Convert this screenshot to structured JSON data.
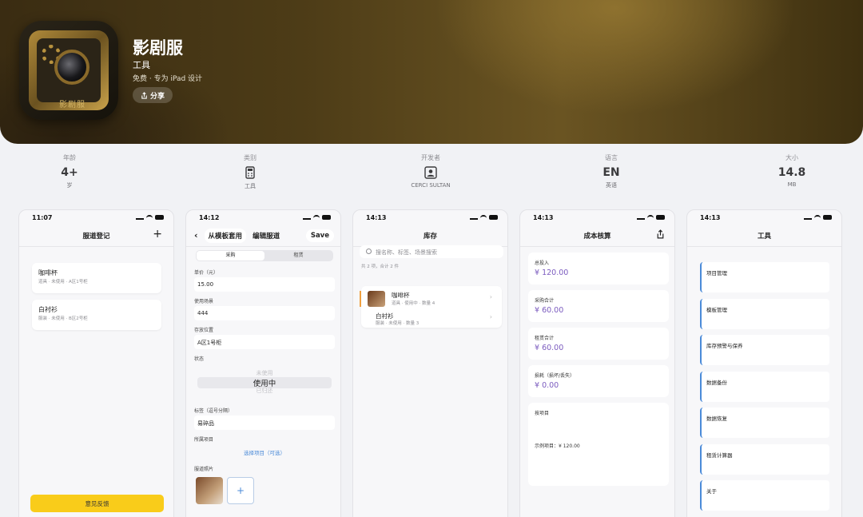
{
  "app": {
    "title": "影剧服",
    "category": "工具",
    "subtitle": "免费 · 专为 iPad 设计",
    "share_label": "分享",
    "icon_text": "影剧服"
  },
  "stats": [
    {
      "label": "年龄",
      "value": "4+",
      "sub": "岁"
    },
    {
      "label": "类别",
      "value": "",
      "sub": "工具",
      "icon": "calculator-icon"
    },
    {
      "label": "开发者",
      "value": "",
      "sub": "CERCI SULTAN",
      "icon": "person-icon"
    },
    {
      "label": "语言",
      "value": "EN",
      "sub": "英语"
    },
    {
      "label": "大小",
      "value": "14.8",
      "sub": "MB"
    }
  ],
  "screens": {
    "s1": {
      "time": "11:07",
      "title": "服道登记",
      "items": [
        {
          "name": "咖啡杯",
          "meta": "道具 · 未使用 · A区1号柜"
        },
        {
          "name": "白衬衫",
          "meta": "服装 · 未使用 · B区2号柜"
        }
      ],
      "feedback": "意见反馈"
    },
    "s2": {
      "time": "14:12",
      "left_btn": "从模板套用",
      "title": "编辑服道",
      "save": "Save",
      "seg_on": "采购",
      "seg_off": "租赁",
      "fields": [
        {
          "label": "单价（元）",
          "value": "15.00"
        },
        {
          "label": "使用场景",
          "value": "444"
        },
        {
          "label": "存放位置",
          "value": "A区1号柜"
        }
      ],
      "status_label": "状态",
      "picker": [
        "未使用",
        "使用中",
        "已归还"
      ],
      "tags_label": "标签（逗号分隔）",
      "tags_value": "易碎品",
      "project_label": "所属项目",
      "project_placeholder": "选择项目（可选）",
      "photo_label": "服道照片"
    },
    "s3": {
      "time": "14:13",
      "title": "库存",
      "search_placeholder": "搜名称、标签、场景搜索",
      "summary": "共 2 项，合计 2 件",
      "items": [
        {
          "name": "咖啡杯",
          "meta": "道具 · 使用中 · 数量 4"
        },
        {
          "name": "白衬衫",
          "meta": "服装 · 未使用 · 数量 3"
        }
      ]
    },
    "s4": {
      "time": "14:13",
      "title": "成本核算",
      "cards": [
        {
          "label": "总投入",
          "value": "¥ 120.00"
        },
        {
          "label": "采购合计",
          "value": "¥ 60.00"
        },
        {
          "label": "租赁合计",
          "value": "¥ 60.00"
        },
        {
          "label": "损耗（损坏/丢失）",
          "value": "¥ 0.00"
        }
      ],
      "by_project_label": "按项目",
      "by_project_row": "示例项目：¥ 120.00"
    },
    "s5": {
      "time": "14:13",
      "title": "工具",
      "items": [
        "项目管理",
        "模板管理",
        "库存预警与保养",
        "数据备份",
        "数据恢复",
        "租赁计算器",
        "关于"
      ]
    }
  },
  "colors": {
    "accent": "#7b5bbf",
    "feedback": "#f9cc1a",
    "tool_bar": "#4a8ad8"
  }
}
